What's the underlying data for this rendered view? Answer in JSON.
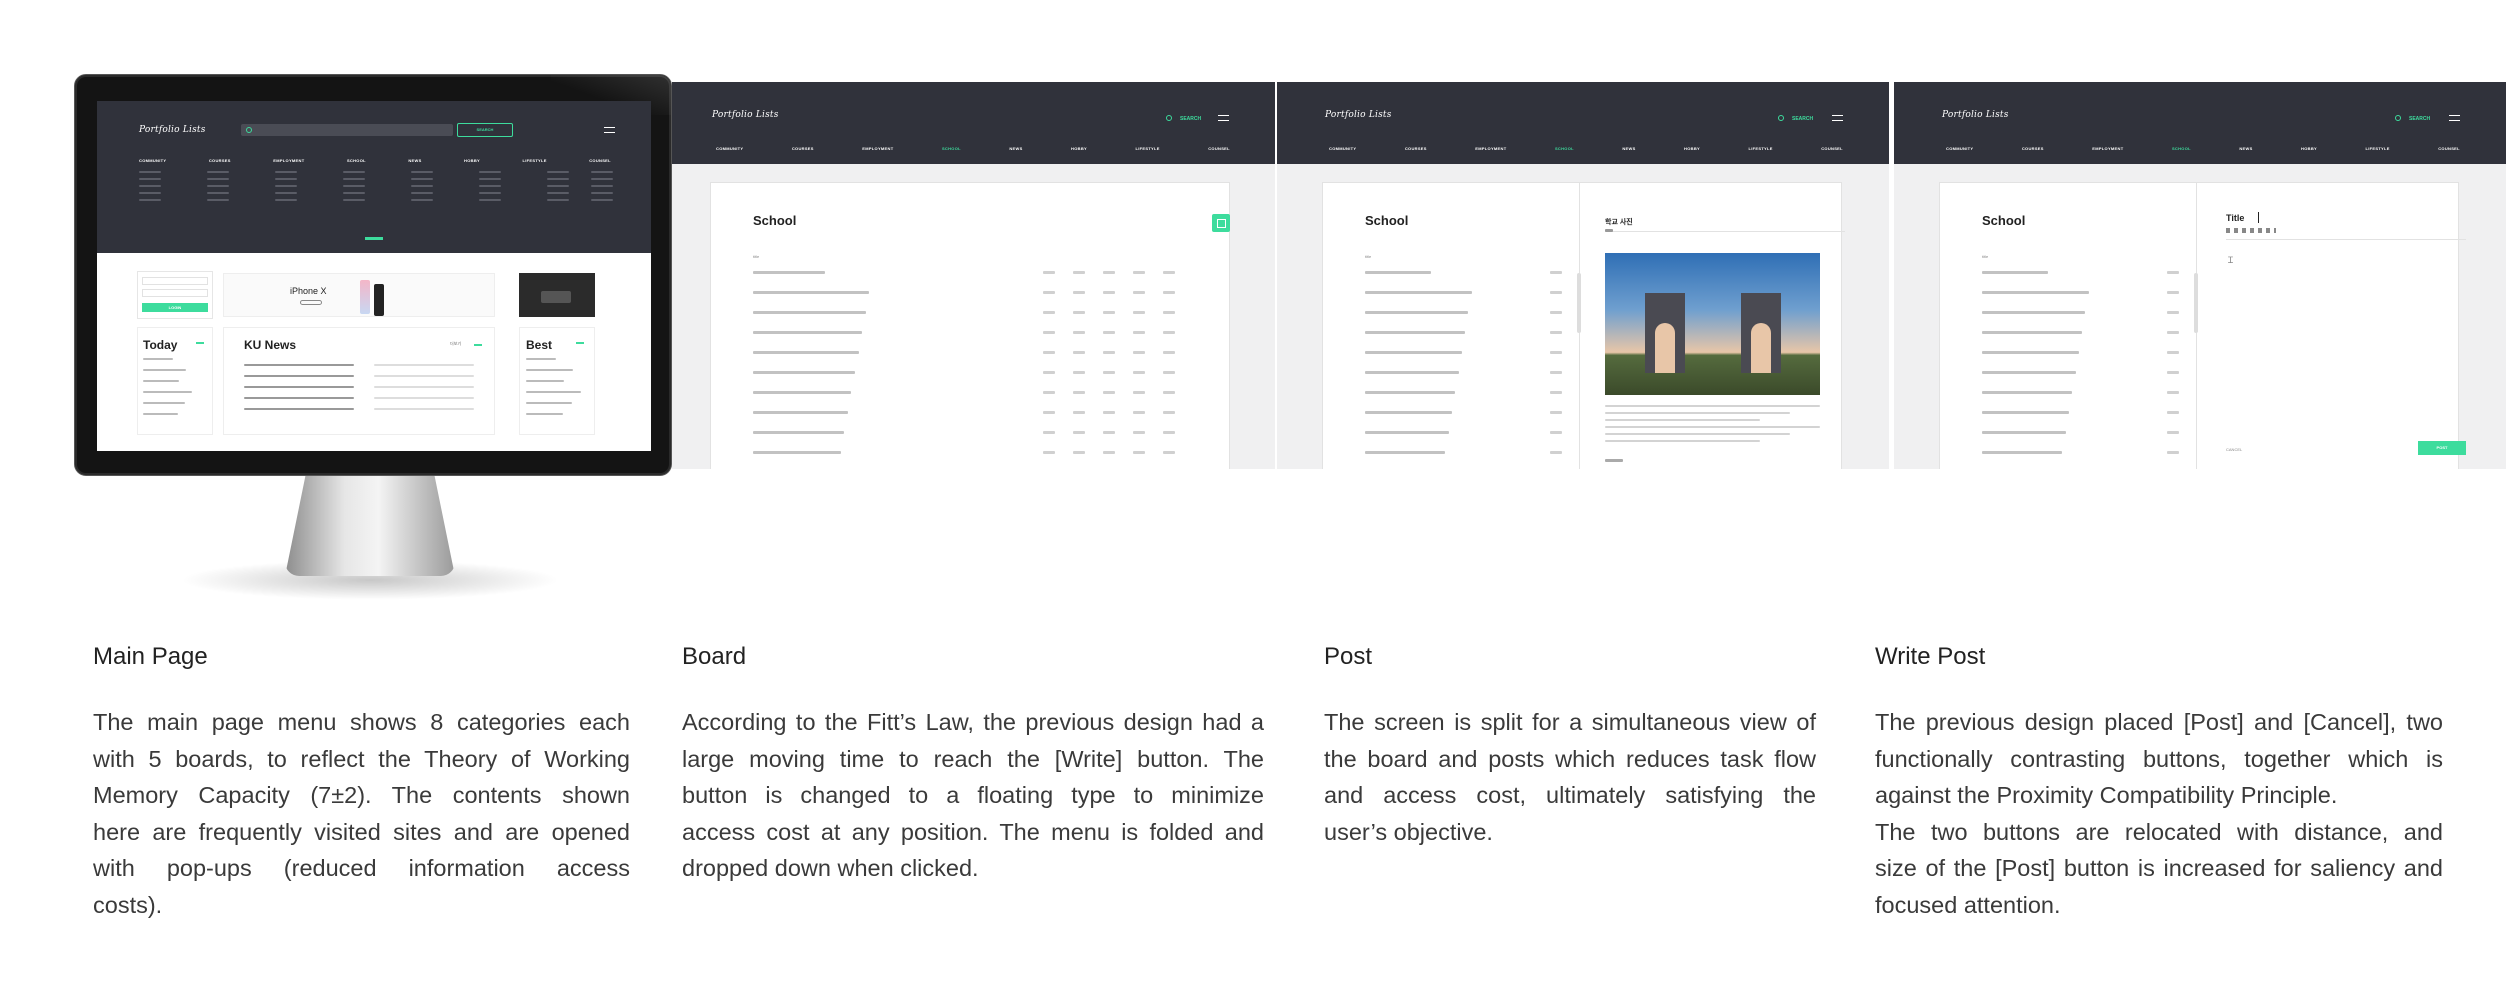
{
  "app": {
    "logo": "Portfolio Lists",
    "search_label": "SEARCH",
    "menu": [
      "COMMUNITY",
      "COURSES",
      "EMPLOYMENT",
      "SCHOOL",
      "NEWS",
      "HOBBY",
      "LIFESTYLE",
      "COUNSEL"
    ],
    "active_menu": "SCHOOL",
    "accent": "#3ddc9d",
    "header_color": "#30323b"
  },
  "main_page": {
    "login_label": "LOGIN",
    "banner_product": "iPhone X",
    "today_title": "Today",
    "news_title": "KU News",
    "news_more": "더보기",
    "best_title": "Best"
  },
  "board": {
    "title": "School",
    "col_title": "title"
  },
  "post": {
    "title": "School",
    "post_heading": "학교 사진"
  },
  "write": {
    "title": "School",
    "editor_title": "Title",
    "post_button": "POST",
    "cancel_label": "CANCEL"
  },
  "captions": [
    {
      "title": "Main Page",
      "lines": [
        "The main page menu shows 8 categories each",
        "with 5 boards, to reflect the Theory of Working",
        "Memory Capacity (7±2). The contents shown",
        "here are frequently visited sites and are opened",
        "with pop-ups (reduced information access",
        "costs)."
      ]
    },
    {
      "title": "Board",
      "lines": [
        "According to the Fitt’s Law, the previous design had a",
        "large moving time to reach the [Write] button. The",
        "button is changed to a floating type to minimize",
        "access cost at any position. The menu is folded and",
        "dropped down when clicked."
      ]
    },
    {
      "title": "Post",
      "lines": [
        "The screen is split for a simultaneous view of",
        "the board and posts which reduces task flow",
        "and access cost, ultimately satisfying the",
        "user’s objective."
      ]
    },
    {
      "title": "Write Post",
      "lines": [
        "The previous design placed [Post] and [Cancel], two",
        "functionally contrasting buttons, together which is",
        "against the Proximity Compatibility Principle.",
        "The two buttons are relocated with distance, and",
        "size of the [Post] button is increased for saliency and",
        "focused attention."
      ]
    }
  ]
}
